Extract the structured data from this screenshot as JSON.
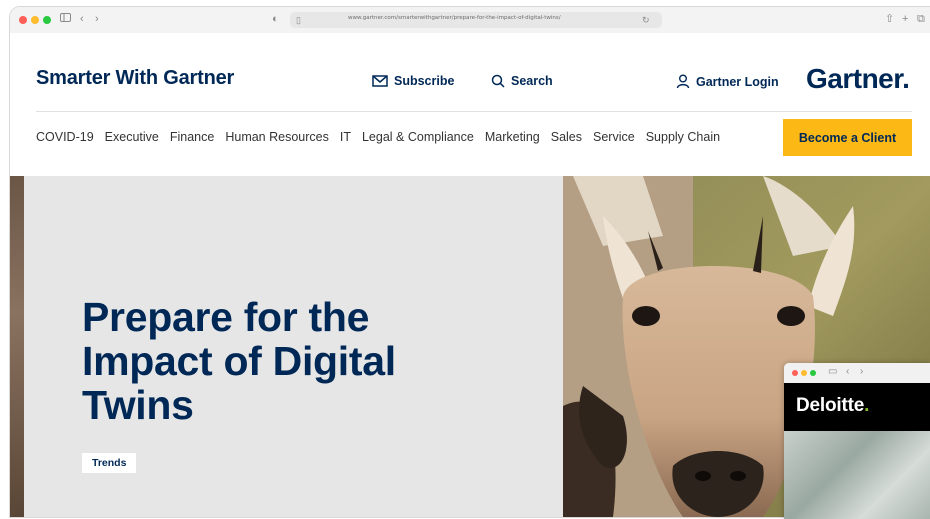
{
  "browser": {
    "url": "www.gartner.com/smarterwithgartner/prepare-for-the-impact-of-digital-twins/",
    "colors": {
      "close": "#ff5f57",
      "minimize": "#febc2e",
      "zoom": "#28c840"
    },
    "icons": [
      "sidebar-icon",
      "back-icon",
      "forward-icon",
      "shield-icon",
      "share-icon",
      "new-tab-icon",
      "tabs-icon"
    ]
  },
  "header": {
    "brand": "Smarter With Gartner",
    "subscribe": "Subscribe",
    "search": "Search",
    "login": "Gartner Login",
    "logo": "Gartner",
    "logo_dot": "."
  },
  "nav": {
    "items": [
      "COVID-19",
      "Executive",
      "Finance",
      "Human Resources",
      "IT",
      "Legal & Compliance",
      "Marketing",
      "Sales",
      "Service",
      "Supply Chain"
    ],
    "cta": "Become a Client"
  },
  "hero": {
    "title": "Prepare for the Impact of Digital Twins",
    "tag": "Trends"
  },
  "popup": {
    "brand": "Deloitte",
    "brand_dot": "."
  },
  "colors": {
    "navy": "#002856",
    "accent_yellow": "#fcb814",
    "deloitte_green": "#86bc25"
  }
}
